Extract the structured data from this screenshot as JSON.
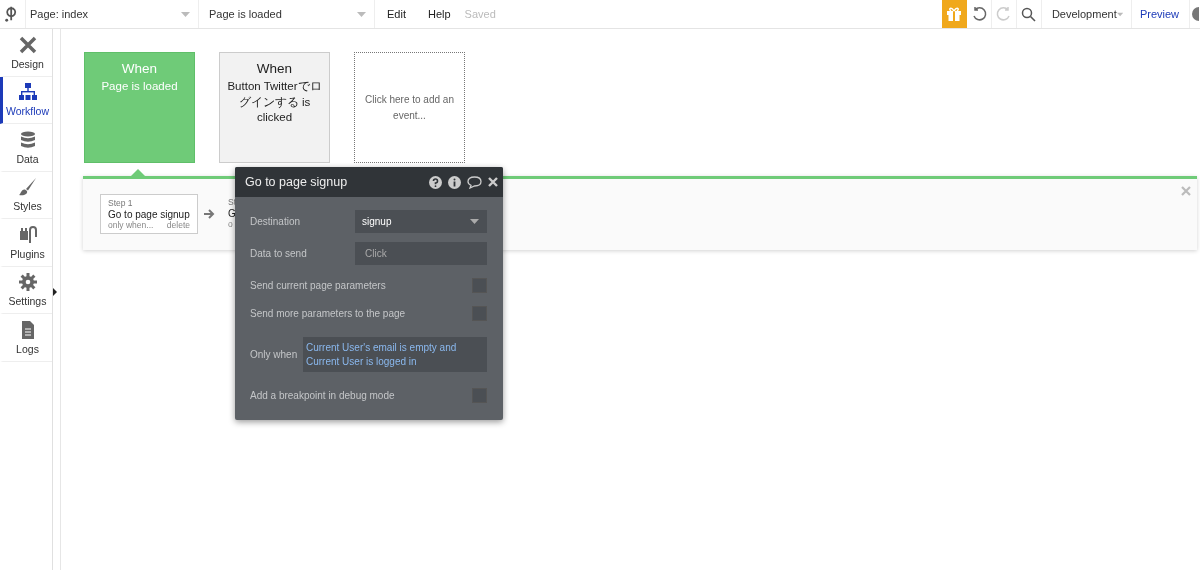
{
  "topbar": {
    "page_select": "Page: index",
    "event_select": "Page is loaded",
    "menu": [
      "Edit",
      "Help"
    ],
    "status": "Saved",
    "history": [
      {
        "kind": "undo",
        "disabled": false
      },
      {
        "kind": "redo",
        "disabled": true
      }
    ],
    "environment": "Development",
    "preview": "Preview"
  },
  "sidebar": {
    "items": [
      {
        "kind": "design",
        "label": "Design",
        "selected": false
      },
      {
        "kind": "workflow",
        "label": "Workflow",
        "selected": true
      },
      {
        "kind": "data",
        "label": "Data",
        "selected": false
      },
      {
        "kind": "styles",
        "label": "Styles",
        "selected": false
      },
      {
        "kind": "plugins",
        "label": "Plugins",
        "selected": false
      },
      {
        "kind": "settings",
        "label": "Settings",
        "selected": false
      },
      {
        "kind": "logs",
        "label": "Logs",
        "selected": false
      }
    ]
  },
  "events": [
    {
      "kind": "event",
      "title": "When",
      "text": "Page is loaded",
      "selected": true
    },
    {
      "kind": "event",
      "title": "When",
      "text": "Button Twitterでログインする is clicked",
      "selected": false
    },
    {
      "kind": "add",
      "text": "Click here to add an event..."
    }
  ],
  "steps": [
    {
      "label": "Step 1",
      "title": "Go to page signup",
      "condition": "only when...",
      "delete": "delete"
    },
    {
      "label": "St",
      "title": "G",
      "condition": "o"
    }
  ],
  "action_editor": {
    "title": "Go to page signup",
    "destination": {
      "label": "Destination",
      "value": "signup"
    },
    "data_to_send": {
      "label": "Data to send",
      "placeholder": "Click"
    },
    "options": [
      {
        "label": "Send current page parameters",
        "checked": false
      },
      {
        "label": "Send more parameters to the page",
        "checked": false
      }
    ],
    "only_when": {
      "label": "Only when",
      "value": "Current User's email is empty and Current User is logged in"
    },
    "breakpoint": {
      "label": "Add a breakpoint in debug mode",
      "checked": false
    }
  }
}
